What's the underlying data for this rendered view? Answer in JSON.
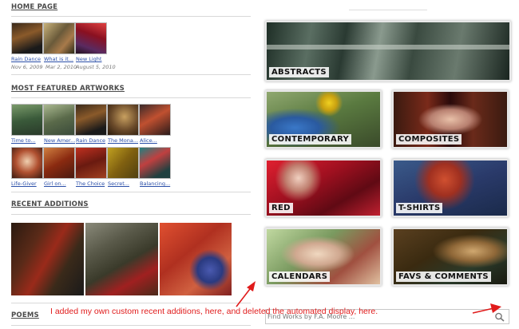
{
  "sections": {
    "home": "HOME PAGE",
    "featured": "MOST FEATURED ARTWORKS",
    "recent": "RECENT ADDITIONS",
    "poems": "POEMS"
  },
  "home_items": [
    {
      "caption": "Rain Dance",
      "date": "Nov 6, 2009"
    },
    {
      "caption": "What is it...",
      "date": "Mar 2, 2010"
    },
    {
      "caption": "New Light",
      "date": "August 5, 2010"
    }
  ],
  "featured_row1": [
    "Time to...",
    "New Amer...",
    "Rain Dance",
    "The Mona...",
    "Alice..."
  ],
  "featured_row2": [
    "Life-Giver",
    "Girl on...",
    "The Choice",
    "Secret...",
    "Balancing..."
  ],
  "categories": [
    "ABSTRACTS",
    "CONTEMPORARY",
    "COMPOSITES",
    "RED",
    "T-SHIRTS",
    "CALENDARS",
    "FAVS & COMMENTS"
  ],
  "search": {
    "placeholder": "Find Works by F.A. Moore ..."
  },
  "annotation": "I added my own custom recent additions, here, and deleted the automated display, here.",
  "colors": {
    "link": "#2b4fa8",
    "annotation": "#e01b1b"
  }
}
